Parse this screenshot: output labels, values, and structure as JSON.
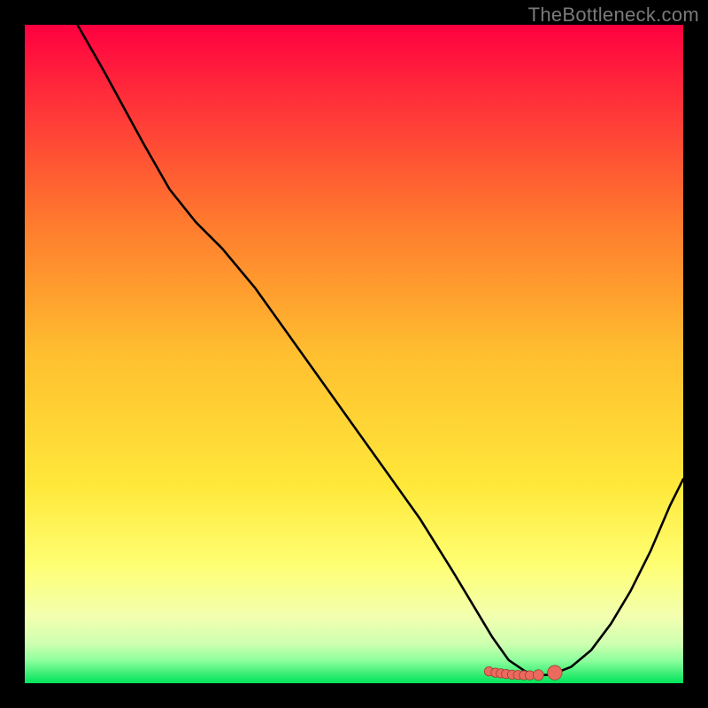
{
  "watermark": "TheBottleneck.com",
  "colors": {
    "bg": "#000000",
    "watermark_text": "#7a7a7a",
    "curve": "#000000",
    "marker_fill": "#ea6a5e",
    "marker_stroke": "#a33d34",
    "grad_top": "#ff0040",
    "grad_mid_upper": "#ff8a2a",
    "grad_mid": "#ffd633",
    "grad_mid_lower": "#ffff66",
    "grad_lower": "#f7ffb3",
    "grad_band": "#b8ffb0",
    "grad_bottom": "#00e35a"
  },
  "chart_data": {
    "type": "line",
    "title": "",
    "xlabel": "",
    "ylabel": "",
    "xlim": [
      0,
      100
    ],
    "ylim": [
      0,
      100
    ],
    "gradient_stops": [
      {
        "offset": 0.0,
        "color": "#ff0040"
      },
      {
        "offset": 0.1,
        "color": "#ff2a3a"
      },
      {
        "offset": 0.3,
        "color": "#ff7a2e"
      },
      {
        "offset": 0.5,
        "color": "#ffbf2f"
      },
      {
        "offset": 0.7,
        "color": "#ffe83a"
      },
      {
        "offset": 0.82,
        "color": "#ffff73"
      },
      {
        "offset": 0.9,
        "color": "#f2ffb0"
      },
      {
        "offset": 0.94,
        "color": "#ceffb0"
      },
      {
        "offset": 0.965,
        "color": "#8fff9e"
      },
      {
        "offset": 1.0,
        "color": "#00e35a"
      }
    ],
    "series": [
      {
        "name": "bottleneck-curve",
        "x": [
          8,
          12,
          18,
          22,
          26,
          30,
          35,
          40,
          45,
          50,
          55,
          60,
          65,
          68,
          71,
          73.5,
          76,
          78,
          80,
          83,
          86,
          89,
          92,
          95,
          98,
          100
        ],
        "y": [
          100,
          93,
          82,
          75,
          70,
          66,
          60,
          53,
          46,
          39,
          32,
          25,
          17,
          12,
          7,
          3.5,
          1.8,
          1.2,
          1.3,
          2.5,
          5,
          9,
          14,
          20,
          27,
          31
        ]
      }
    ],
    "markers": {
      "name": "optimal-range",
      "points": [
        {
          "x": 70.5,
          "y": 1.8,
          "r": 0.7
        },
        {
          "x": 71.5,
          "y": 1.6,
          "r": 0.7
        },
        {
          "x": 72.3,
          "y": 1.5,
          "r": 0.7
        },
        {
          "x": 73.1,
          "y": 1.4,
          "r": 0.7
        },
        {
          "x": 74.0,
          "y": 1.3,
          "r": 0.7
        },
        {
          "x": 74.9,
          "y": 1.25,
          "r": 0.7
        },
        {
          "x": 75.8,
          "y": 1.2,
          "r": 0.7
        },
        {
          "x": 76.7,
          "y": 1.2,
          "r": 0.7
        },
        {
          "x": 78.0,
          "y": 1.25,
          "r": 0.8
        },
        {
          "x": 80.5,
          "y": 1.6,
          "r": 1.1
        }
      ]
    }
  }
}
